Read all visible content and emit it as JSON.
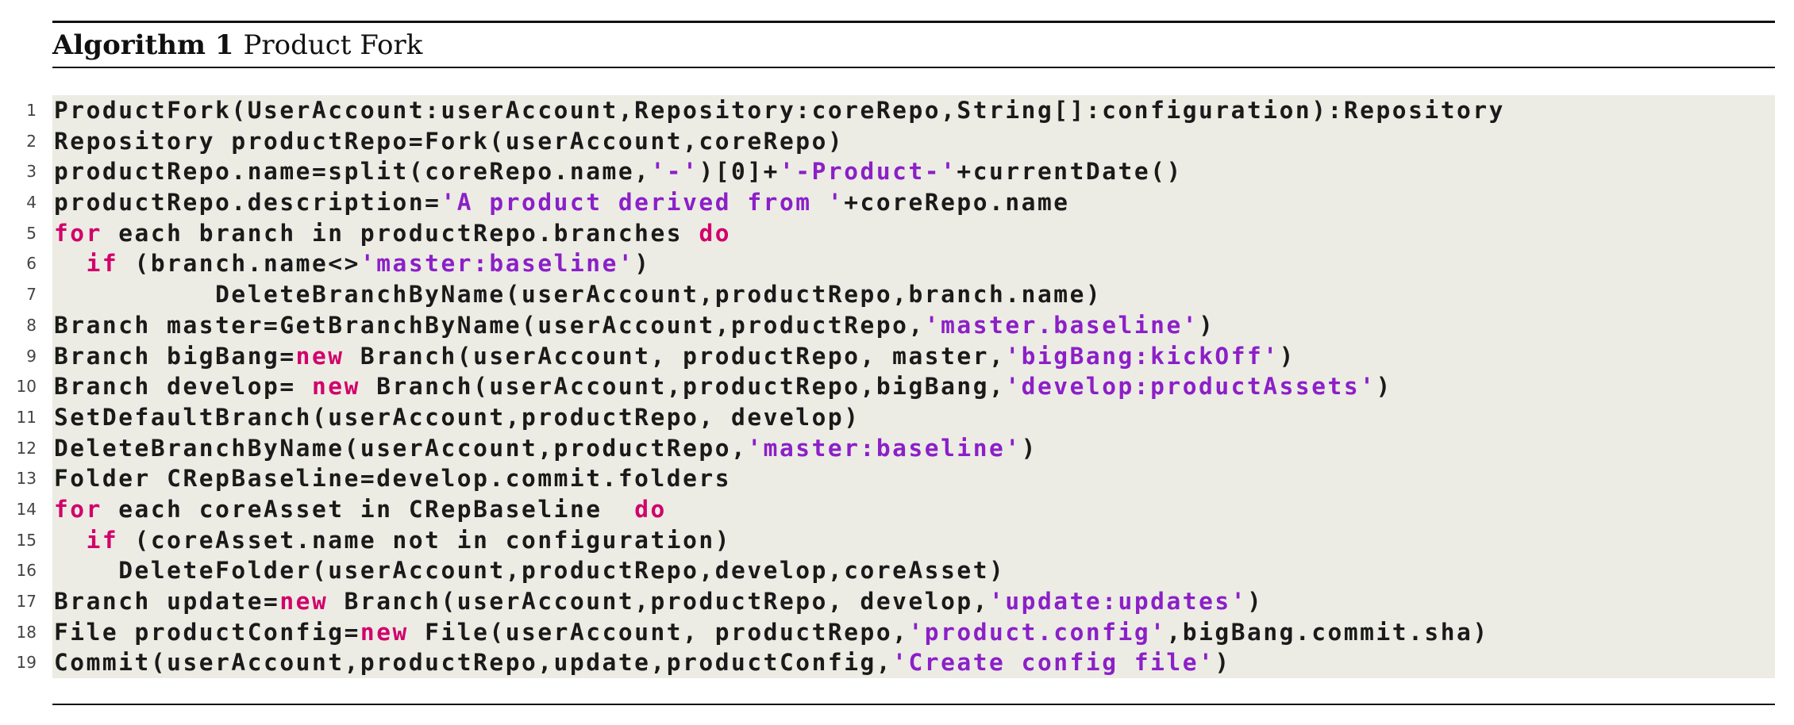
{
  "algorithm": {
    "label": "Algorithm 1",
    "title": "Product Fork"
  },
  "colors": {
    "keyword": "#d1006b",
    "string": "#8c1fc8",
    "code_background": "#ecece4",
    "text": "#1a1a1a"
  },
  "code_lines": [
    {
      "num": "1",
      "indent": "",
      "tokens": [
        {
          "t": "ProductFork(UserAccount:userAccount,Repository:coreRepo,String[]:configuration):Repository",
          "k": "plain"
        }
      ]
    },
    {
      "num": "2",
      "indent": "",
      "tokens": [
        {
          "t": "Repository productRepo=Fork(userAccount,coreRepo)",
          "k": "plain"
        }
      ]
    },
    {
      "num": "3",
      "indent": "",
      "tokens": [
        {
          "t": "productRepo.name=split(coreRepo.name,",
          "k": "plain"
        },
        {
          "t": "'-'",
          "k": "str"
        },
        {
          "t": ")[0]+",
          "k": "plain"
        },
        {
          "t": "'-Product-'",
          "k": "str"
        },
        {
          "t": "+currentDate()",
          "k": "plain"
        }
      ]
    },
    {
      "num": "4",
      "indent": "",
      "tokens": [
        {
          "t": "productRepo.description=",
          "k": "plain"
        },
        {
          "t": "'A product derived from '",
          "k": "str"
        },
        {
          "t": "+coreRepo.name",
          "k": "plain"
        }
      ]
    },
    {
      "num": "5",
      "indent": "",
      "tokens": [
        {
          "t": "for",
          "k": "kw"
        },
        {
          "t": " each branch in productRepo.branches ",
          "k": "plain"
        },
        {
          "t": "do",
          "k": "kw"
        }
      ]
    },
    {
      "num": "6",
      "indent": "  ",
      "tokens": [
        {
          "t": "if",
          "k": "kw"
        },
        {
          "t": " (branch.name<>",
          "k": "plain"
        },
        {
          "t": "'master:baseline'",
          "k": "str"
        },
        {
          "t": ")",
          "k": "plain"
        }
      ]
    },
    {
      "num": "7",
      "indent": "          ",
      "tokens": [
        {
          "t": "DeleteBranchByName(userAccount,productRepo,branch.name)",
          "k": "plain"
        }
      ]
    },
    {
      "num": "8",
      "indent": "",
      "tokens": [
        {
          "t": "Branch master=GetBranchByName(userAccount,productRepo,",
          "k": "plain"
        },
        {
          "t": "'master.baseline'",
          "k": "str"
        },
        {
          "t": ")",
          "k": "plain"
        }
      ]
    },
    {
      "num": "9",
      "indent": "",
      "tokens": [
        {
          "t": "Branch bigBang=",
          "k": "plain"
        },
        {
          "t": "new",
          "k": "kw"
        },
        {
          "t": " Branch(userAccount, productRepo, master,",
          "k": "plain"
        },
        {
          "t": "'bigBang:kickOff'",
          "k": "str"
        },
        {
          "t": ")",
          "k": "plain"
        }
      ]
    },
    {
      "num": "10",
      "indent": "",
      "tokens": [
        {
          "t": "Branch develop= ",
          "k": "plain"
        },
        {
          "t": "new",
          "k": "kw"
        },
        {
          "t": " Branch(userAccount,productRepo,bigBang,",
          "k": "plain"
        },
        {
          "t": "'develop:productAssets'",
          "k": "str"
        },
        {
          "t": ")",
          "k": "plain"
        }
      ]
    },
    {
      "num": "11",
      "indent": "",
      "tokens": [
        {
          "t": "SetDefaultBranch(userAccount,productRepo, develop)",
          "k": "plain"
        }
      ]
    },
    {
      "num": "12",
      "indent": "",
      "tokens": [
        {
          "t": "DeleteBranchByName(userAccount,productRepo,",
          "k": "plain"
        },
        {
          "t": "'master:baseline'",
          "k": "str"
        },
        {
          "t": ")",
          "k": "plain"
        }
      ]
    },
    {
      "num": "13",
      "indent": "",
      "tokens": [
        {
          "t": "Folder CRepBaseline=develop.commit.folders",
          "k": "plain"
        }
      ]
    },
    {
      "num": "14",
      "indent": "",
      "tokens": [
        {
          "t": "for",
          "k": "kw"
        },
        {
          "t": " each coreAsset in CRepBaseline  ",
          "k": "plain"
        },
        {
          "t": "do",
          "k": "kw"
        }
      ]
    },
    {
      "num": "15",
      "indent": "  ",
      "tokens": [
        {
          "t": "if",
          "k": "kw"
        },
        {
          "t": " (coreAsset.name not in configuration)",
          "k": "plain"
        }
      ]
    },
    {
      "num": "16",
      "indent": "    ",
      "tokens": [
        {
          "t": "DeleteFolder(userAccount,productRepo,develop,coreAsset)",
          "k": "plain"
        }
      ]
    },
    {
      "num": "17",
      "indent": "",
      "tokens": [
        {
          "t": "Branch update=",
          "k": "plain"
        },
        {
          "t": "new",
          "k": "kw"
        },
        {
          "t": " Branch(userAccount,productRepo, develop,",
          "k": "plain"
        },
        {
          "t": "'update:updates'",
          "k": "str"
        },
        {
          "t": ")",
          "k": "plain"
        }
      ]
    },
    {
      "num": "18",
      "indent": "",
      "tokens": [
        {
          "t": "File productConfig=",
          "k": "plain"
        },
        {
          "t": "new",
          "k": "kw"
        },
        {
          "t": " File(userAccount, productRepo,",
          "k": "plain"
        },
        {
          "t": "'product.config'",
          "k": "str"
        },
        {
          "t": ",bigBang.commit.sha)",
          "k": "plain"
        }
      ]
    },
    {
      "num": "19",
      "indent": "",
      "tokens": [
        {
          "t": "Commit(userAccount,productRepo,update,productConfig,",
          "k": "plain"
        },
        {
          "t": "'Create config file'",
          "k": "str"
        },
        {
          "t": ")",
          "k": "plain"
        }
      ]
    }
  ]
}
